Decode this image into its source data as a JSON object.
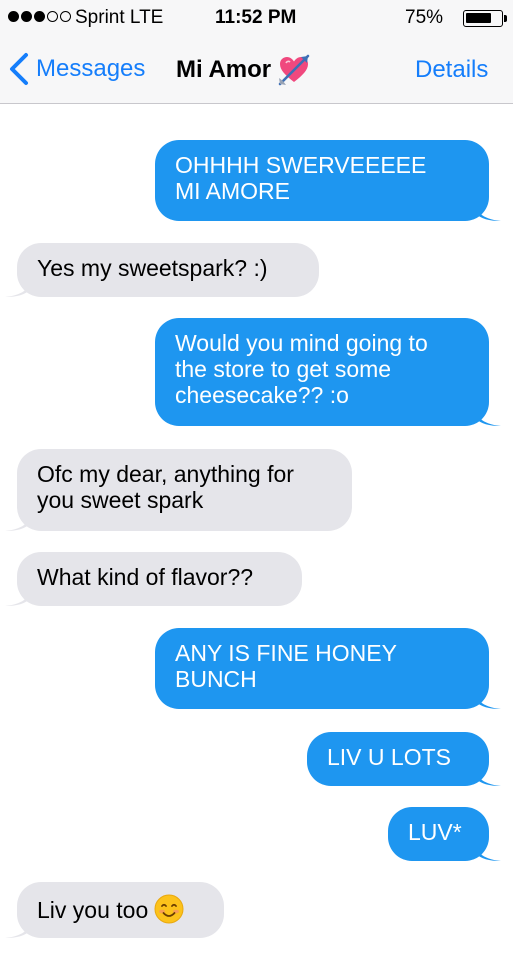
{
  "status_bar": {
    "carrier": "Sprint  LTE",
    "time": "11:52 PM",
    "battery": "75%",
    "battery_level": 0.75,
    "signal_bars_filled": 3,
    "signal_bars_total": 5
  },
  "nav": {
    "back_label": "Messages",
    "title": "Mi Amor",
    "title_icon": "heart-with-arrow-icon",
    "details_label": "Details"
  },
  "colors": {
    "accent": "#157efb",
    "sent_bubble": "#1e96f0",
    "received_bubble": "#e5e5ea"
  },
  "messages": [
    {
      "direction": "sent",
      "text": "OHHHH SWERVEEEEE\nMI AMORE"
    },
    {
      "direction": "received",
      "text": "Yes my sweetspark? :)"
    },
    {
      "direction": "sent",
      "text": "Would you mind going to\nthe store to get some\ncheesecake?? :o"
    },
    {
      "direction": "received",
      "text": "Ofc my dear, anything for\nyou sweet spark"
    },
    {
      "direction": "received",
      "text": "What kind of flavor??"
    },
    {
      "direction": "sent",
      "text": "ANY IS FINE HONEY\nBUNCH"
    },
    {
      "direction": "sent",
      "text": "LIV U LOTS"
    },
    {
      "direction": "sent",
      "text": "LUV*"
    },
    {
      "direction": "received",
      "text": "Liv you too",
      "emoji": "smiling-face-icon"
    }
  ]
}
